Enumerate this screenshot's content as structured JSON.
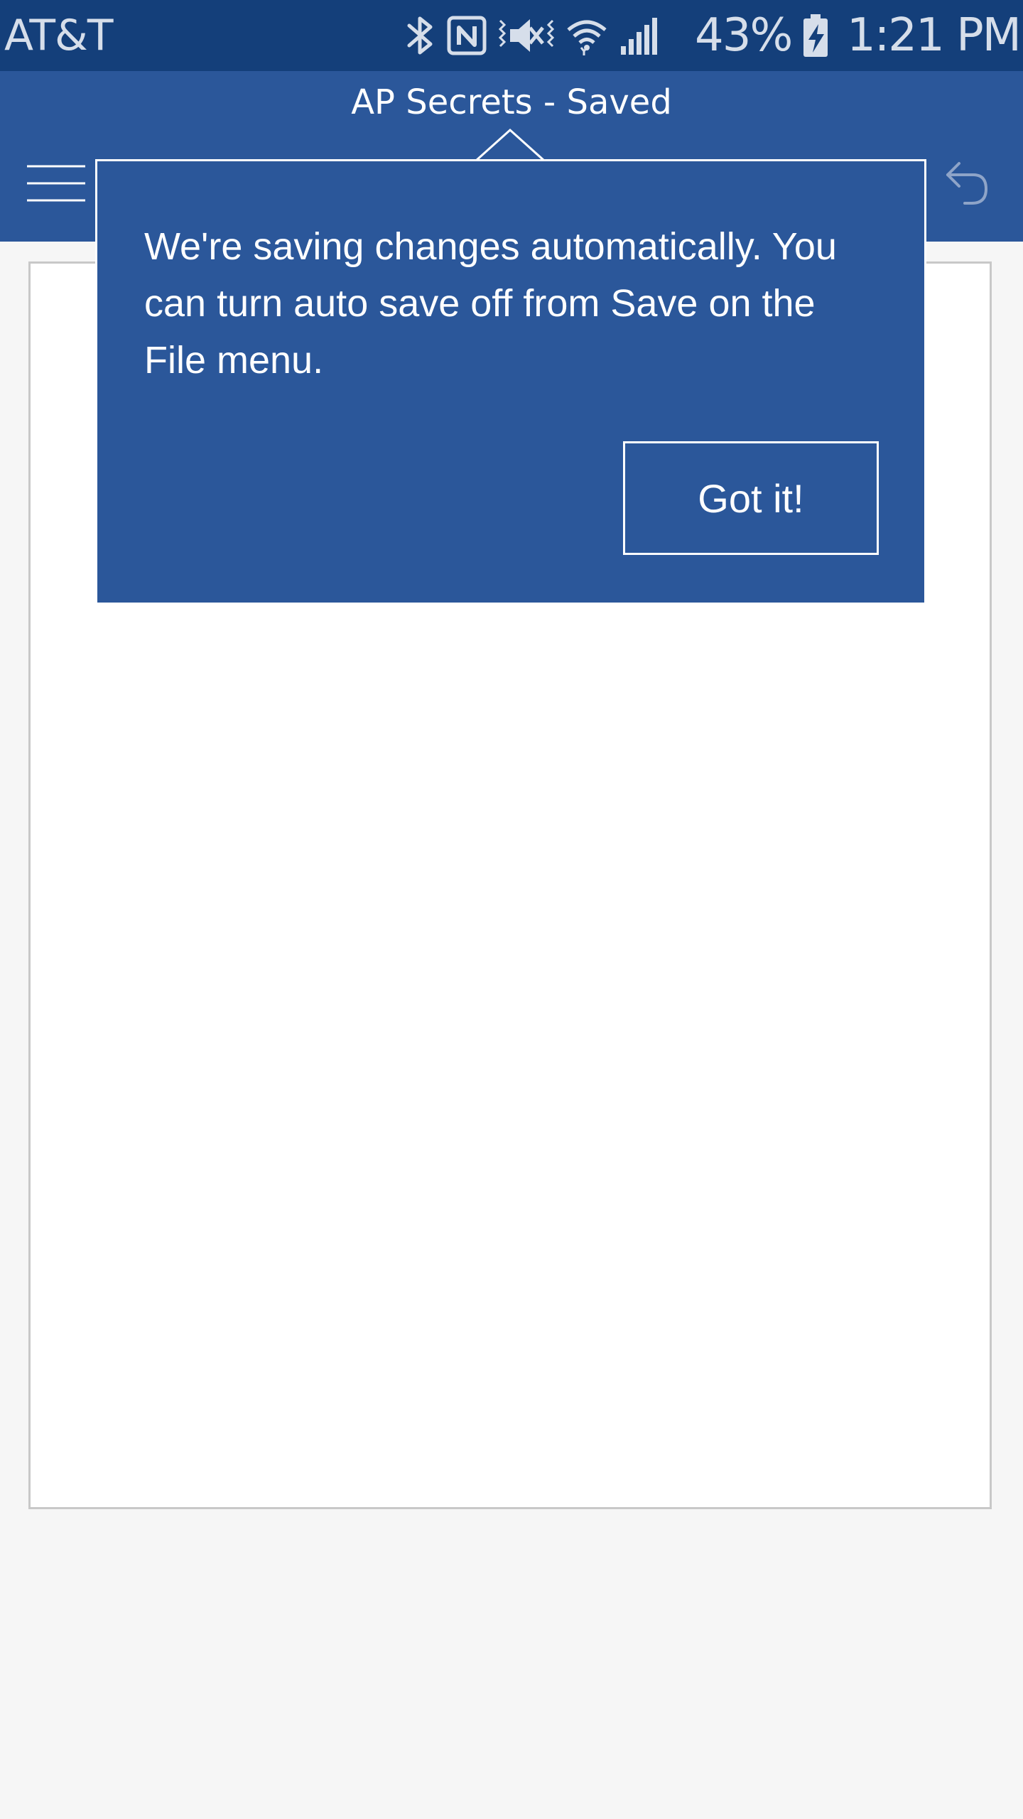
{
  "status_bar": {
    "carrier": "AT&T",
    "battery_percent": "43%",
    "time": "1:21 PM",
    "icons": [
      "bluetooth-icon",
      "nfc-icon",
      "mute-icon",
      "wifi-icon",
      "signal-icon",
      "battery-charging-icon"
    ]
  },
  "app_bar": {
    "document_title": "AP Secrets - Saved",
    "icons": [
      "menu-icon",
      "undo-icon"
    ]
  },
  "callout": {
    "message": "We're saving changes automatically. You can turn auto save off from Save on the File menu.",
    "dismiss_label": "Got it!"
  },
  "colors": {
    "status_bar_bg": "#143f7a",
    "app_bar_bg": "#2b579a",
    "callout_bg": "#2b579a",
    "page_bg": "#ffffff",
    "canvas_bg": "#f6f6f6"
  }
}
